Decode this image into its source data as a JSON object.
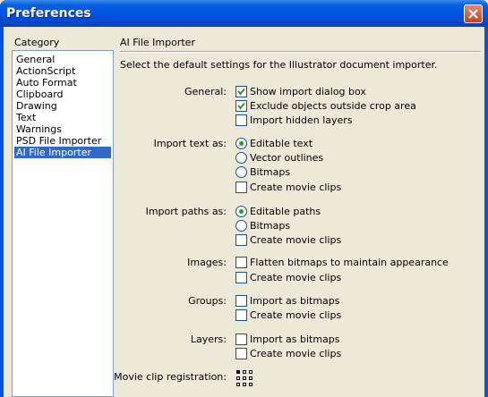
{
  "window": {
    "title": "Preferences"
  },
  "category": {
    "label": "Category",
    "items": [
      "General",
      "ActionScript",
      "Auto Format",
      "Clipboard",
      "Drawing",
      "Text",
      "Warnings",
      "PSD File Importer",
      "AI File Importer"
    ],
    "selected": "AI File Importer"
  },
  "panel": {
    "title": "AI File Importer",
    "description": "Select the default settings for the Illustrator document importer.",
    "general": {
      "label": "General:",
      "show_dialog": {
        "text": "Show import dialog box",
        "checked": true
      },
      "exclude_outside": {
        "text": "Exclude objects outside crop area",
        "checked": true
      },
      "import_hidden": {
        "text": "Import hidden layers",
        "checked": false
      }
    },
    "text": {
      "label": "Import text as:",
      "editable": {
        "text": "Editable text",
        "selected": true
      },
      "vector": {
        "text": "Vector outlines",
        "selected": false
      },
      "bitmaps": {
        "text": "Bitmaps",
        "selected": false
      },
      "movie_clips": {
        "text": "Create movie clips",
        "checked": false
      }
    },
    "paths": {
      "label": "Import paths as:",
      "editable": {
        "text": "Editable paths",
        "selected": true
      },
      "bitmaps": {
        "text": "Bitmaps",
        "selected": false
      },
      "movie_clips": {
        "text": "Create movie clips",
        "checked": false
      }
    },
    "images": {
      "label": "Images:",
      "flatten": {
        "text": "Flatten bitmaps to maintain appearance",
        "checked": false
      },
      "movie_clips": {
        "text": "Create movie clips",
        "checked": false
      }
    },
    "groups": {
      "label": "Groups:",
      "import_bitmaps": {
        "text": "Import as bitmaps",
        "checked": false
      },
      "movie_clips": {
        "text": "Create movie clips",
        "checked": false
      }
    },
    "layers": {
      "label": "Layers:",
      "import_bitmaps": {
        "text": "Import as bitmaps",
        "checked": false
      },
      "movie_clips": {
        "text": "Create movie clips",
        "checked": false
      }
    },
    "registration": {
      "label": "Movie clip registration:",
      "selected_cell": "top-left"
    }
  },
  "colors": {
    "title_bar": "#0054e3",
    "selection": "#316ac5",
    "dialog_bg": "#ece9d8",
    "radio_dot": "#21a121"
  },
  "icons": {
    "close": "close-icon",
    "check": "check-icon"
  }
}
